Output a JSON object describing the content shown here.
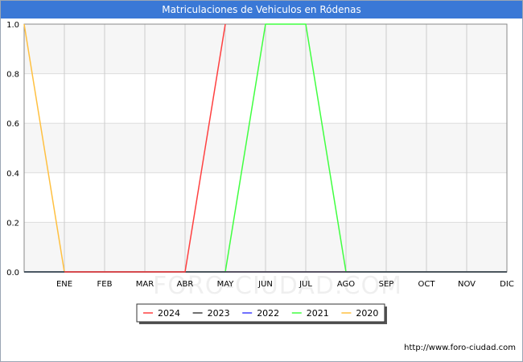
{
  "chart_data": {
    "type": "line",
    "title": "Matriculaciones de Vehiculos en Ródenas",
    "xlabel": "",
    "ylabel": "",
    "ylim": [
      0,
      1
    ],
    "yticks": [
      "0.0",
      "0.2",
      "0.4",
      "0.6",
      "0.8",
      "1.0"
    ],
    "categories": [
      "",
      "ENE",
      "FEB",
      "MAR",
      "ABR",
      "MAY",
      "JUN",
      "JUL",
      "AGO",
      "SEP",
      "OCT",
      "NOV",
      "DIC"
    ],
    "grid": true,
    "legend_position": "bottom",
    "watermark": "FORO-CIUDAD.COM",
    "series": [
      {
        "name": "2024",
        "color": "#ff4040",
        "values": [
          null,
          0,
          0,
          0,
          0,
          1,
          null,
          null,
          null,
          null,
          null,
          null,
          null
        ]
      },
      {
        "name": "2023",
        "color": "#404040",
        "values": [
          0,
          0,
          0,
          0,
          0,
          0,
          0,
          0,
          0,
          0,
          0,
          0,
          0
        ]
      },
      {
        "name": "2022",
        "color": "#4040ff",
        "values": [
          0,
          0,
          0,
          0,
          0,
          0,
          0,
          0,
          0,
          0,
          0,
          0,
          0
        ]
      },
      {
        "name": "2021",
        "color": "#40ff40",
        "values": [
          0,
          0,
          0,
          0,
          0,
          0,
          1,
          1,
          0,
          0,
          0,
          0,
          0
        ]
      },
      {
        "name": "2020",
        "color": "#ffc040",
        "values": [
          1,
          0,
          0,
          0,
          0,
          0,
          0,
          0,
          0,
          0,
          0,
          0,
          0
        ]
      }
    ]
  },
  "footer_url": "http://www.foro-ciudad.com"
}
